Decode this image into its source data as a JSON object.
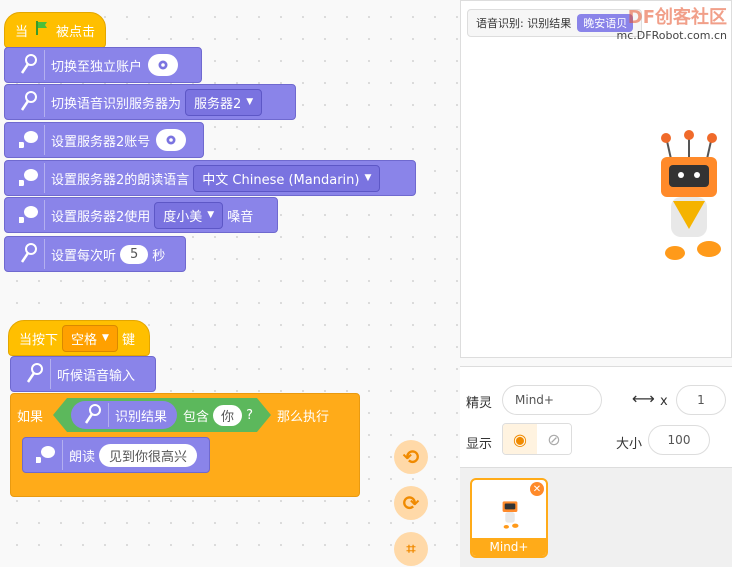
{
  "script1": {
    "hat_when": "当",
    "hat_clicked": "被点击",
    "b1": "切换至独立账户",
    "b2": "切换语音识别服务器为",
    "b2_drop": "服务器2",
    "b3": "设置服务器2账号",
    "b4": "设置服务器2的朗读语言",
    "b4_drop": "中文 Chinese (Mandarin)",
    "b5_pre": "设置服务器2使用",
    "b5_drop": "度小美",
    "b5_post": "嗓音",
    "b6_pre": "设置每次听",
    "b6_val": "5",
    "b6_post": "秒"
  },
  "script2": {
    "hat_pre": "当按下",
    "hat_key": "空格",
    "hat_post": "键",
    "listen": "听候语音输入",
    "if": "如果",
    "result": "识别结果",
    "contains": "包含",
    "word": "你",
    "q": "?",
    "then": "那么执行",
    "speak": "朗读",
    "speak_text": "见到你很高兴"
  },
  "stage": {
    "monitor_label": "语音识别: 识别结果",
    "monitor_value": "晚安语贝",
    "watermark_top": "DF创客社区",
    "watermark_url": "mc.DFRobot.com.cn"
  },
  "sprite": {
    "label_sprite": "精灵",
    "name": "Mind+",
    "x_label": "x",
    "x_value": "1",
    "label_show": "显示",
    "label_size": "大小",
    "size_value": "100",
    "thumb_name": "Mind+"
  },
  "colors": {
    "looks": "#8a84e9",
    "events": "#ffbf00",
    "control": "#ffab19"
  }
}
